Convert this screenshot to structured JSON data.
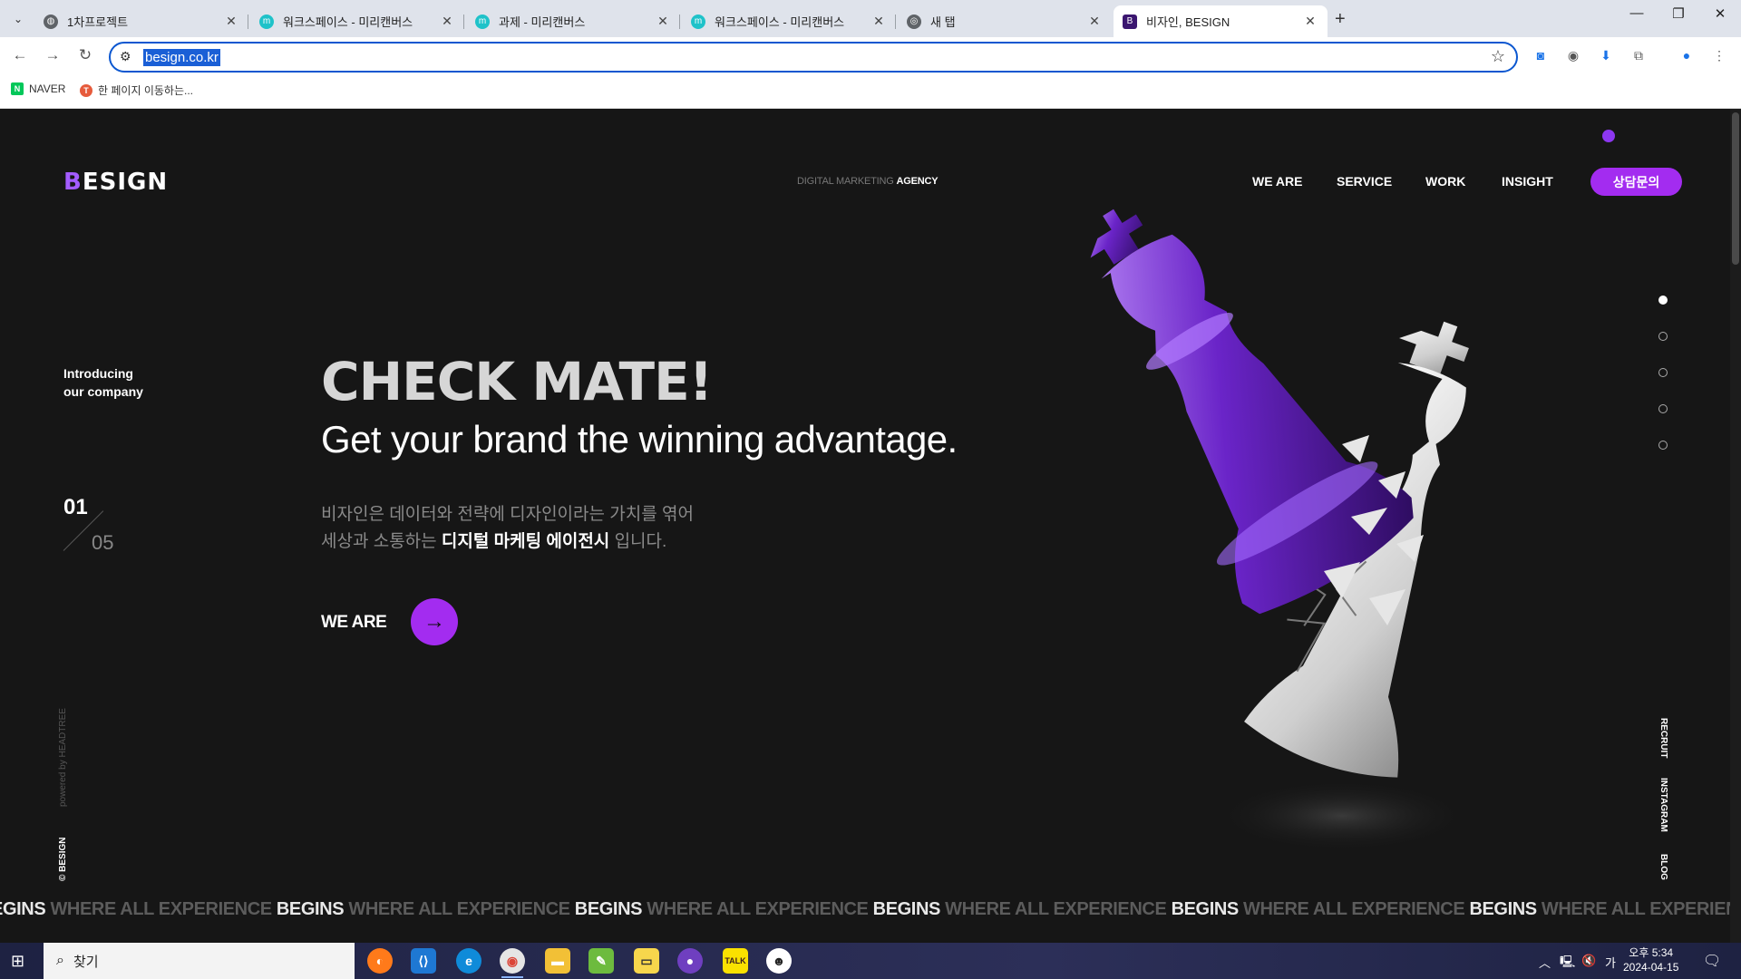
{
  "browser": {
    "tabs": [
      {
        "title": "1차프로젝트",
        "icon": "globe-icon"
      },
      {
        "title": "워크스페이스 - 미리캔버스",
        "icon": "miricanvas-icon"
      },
      {
        "title": "과제 - 미리캔버스",
        "icon": "miricanvas-icon"
      },
      {
        "title": "워크스페이스 - 미리캔버스",
        "icon": "miricanvas-icon"
      },
      {
        "title": "새 탭",
        "icon": "chrome-icon"
      },
      {
        "title": "비자인, BESIGN",
        "icon": "besign-icon",
        "active": true
      }
    ],
    "url": "besign.co.kr",
    "bookmarks": [
      {
        "label": "NAVER",
        "icon": "naver-icon"
      },
      {
        "label": "한 페이지 이동하는...",
        "icon": "bookmark-icon"
      }
    ]
  },
  "site": {
    "logo": "BESIGN",
    "tagline_prefix": "DIGITAL MARKETING",
    "tagline_strong": "AGENCY",
    "nav": [
      "WE ARE",
      "SERVICE",
      "WORK",
      "INSIGHT"
    ],
    "cta": "상담문의",
    "intro_line1": "Introducing",
    "intro_line2": "our company",
    "counter_current": "01",
    "counter_total": "05",
    "headline": "CHECK MATE!",
    "subheadline": "Get your brand the winning advantage.",
    "desc_line1": "비자인은 데이터와 전략에 디자인이라는 가치를 엮어",
    "desc_line2_pre": "세상과 소통하는",
    "desc_line2_strong": "디지털 마케팅 에이전시",
    "desc_line2_post": "입니다.",
    "weare_label": "WE ARE",
    "side_links": [
      "RECRUIT",
      "INSTAGRAM",
      "BLOG"
    ],
    "powered": "powered by HEADTREE",
    "copyright": "© BESIGN",
    "marquee_a": "BEGINS",
    "marquee_b": "WHERE ALL EXPERIENCE",
    "accent": "#a32cf0"
  },
  "taskbar": {
    "search_placeholder": "찾기",
    "time": "오후 5:34",
    "date": "2024-04-15",
    "ime": "가"
  }
}
